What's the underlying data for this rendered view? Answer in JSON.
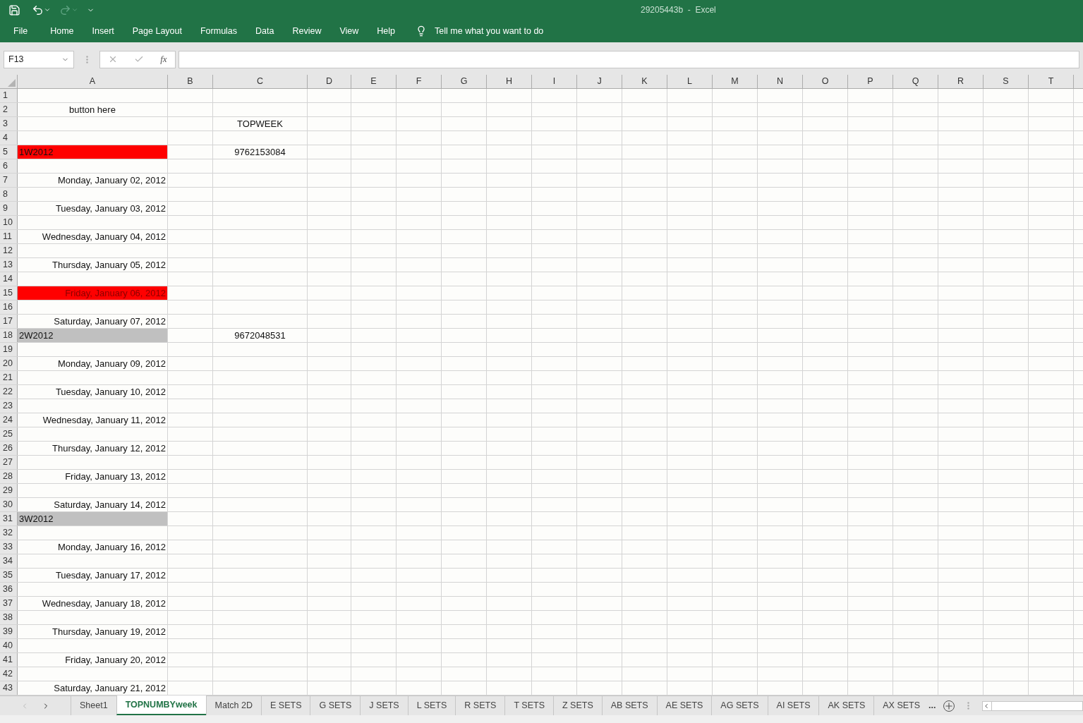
{
  "window": {
    "title": "29205443b  -  Excel"
  },
  "ribbon_tabs": [
    "File",
    "Home",
    "Insert",
    "Page Layout",
    "Formulas",
    "Data",
    "Review",
    "View",
    "Help"
  ],
  "tell_me": "Tell me what you want to do",
  "name_box": "F13",
  "formula_symbol": "fx",
  "columns": [
    "A",
    "B",
    "C",
    "D",
    "E",
    "F",
    "G",
    "H",
    "I",
    "J",
    "K",
    "L",
    "M",
    "N",
    "O",
    "P",
    "Q",
    "R",
    "S",
    "T"
  ],
  "rows": [
    {
      "n": "1"
    },
    {
      "n": "2",
      "a": {
        "text": "button here",
        "kind": "center"
      }
    },
    {
      "n": "3",
      "c": "TOPWEEK"
    },
    {
      "n": "4"
    },
    {
      "n": "5",
      "a": {
        "text": "1W2012",
        "kind": "week"
      },
      "color": "#ff0000",
      "c": "9762153084"
    },
    {
      "n": "6"
    },
    {
      "n": "7",
      "a": {
        "text": "Monday, January 02, 2012",
        "kind": "date"
      }
    },
    {
      "n": "8"
    },
    {
      "n": "9",
      "a": {
        "text": "Tuesday, January 03, 2012",
        "kind": "date"
      }
    },
    {
      "n": "10"
    },
    {
      "n": "11",
      "a": {
        "text": "Wednesday, January 04, 2012",
        "kind": "date"
      }
    },
    {
      "n": "12"
    },
    {
      "n": "13",
      "a": {
        "text": "Thursday, January 05, 2012",
        "kind": "date"
      }
    },
    {
      "n": "14"
    },
    {
      "n": "15",
      "a": {
        "text": "Friday, January 06, 2012",
        "kind": "date"
      },
      "color": "#ff0000"
    },
    {
      "n": "16"
    },
    {
      "n": "17",
      "a": {
        "text": "Saturday, January 07, 2012",
        "kind": "date"
      }
    },
    {
      "n": "18",
      "a": {
        "text": "2W2012",
        "kind": "week"
      },
      "color": "#c0c0c0",
      "c": "9672048531"
    },
    {
      "n": "19"
    },
    {
      "n": "20",
      "a": {
        "text": "Monday, January 09, 2012",
        "kind": "date"
      }
    },
    {
      "n": "21"
    },
    {
      "n": "22",
      "a": {
        "text": "Tuesday, January 10, 2012",
        "kind": "date"
      }
    },
    {
      "n": "23"
    },
    {
      "n": "24",
      "a": {
        "text": "Wednesday, January 11, 2012",
        "kind": "date"
      }
    },
    {
      "n": "25"
    },
    {
      "n": "26",
      "a": {
        "text": "Thursday, January 12, 2012",
        "kind": "date"
      }
    },
    {
      "n": "27"
    },
    {
      "n": "28",
      "a": {
        "text": "Friday, January 13, 2012",
        "kind": "date"
      }
    },
    {
      "n": "29"
    },
    {
      "n": "30",
      "a": {
        "text": "Saturday, January 14, 2012",
        "kind": "date"
      }
    },
    {
      "n": "31",
      "a": {
        "text": "3W2012",
        "kind": "week"
      },
      "color": "#c0c0c0"
    },
    {
      "n": "32"
    },
    {
      "n": "33",
      "a": {
        "text": "Monday, January 16, 2012",
        "kind": "date"
      }
    },
    {
      "n": "34"
    },
    {
      "n": "35",
      "a": {
        "text": "Tuesday, January 17, 2012",
        "kind": "date"
      }
    },
    {
      "n": "36"
    },
    {
      "n": "37",
      "a": {
        "text": "Wednesday, January 18, 2012",
        "kind": "date"
      }
    },
    {
      "n": "38"
    },
    {
      "n": "39",
      "a": {
        "text": "Thursday, January 19, 2012",
        "kind": "date"
      }
    },
    {
      "n": "40"
    },
    {
      "n": "41",
      "a": {
        "text": "Friday, January 20, 2012",
        "kind": "date"
      }
    },
    {
      "n": "42"
    },
    {
      "n": "43",
      "a": {
        "text": "Saturday, January 21, 2012",
        "kind": "date"
      }
    }
  ],
  "sheet_tabs": [
    {
      "label": "Sheet1",
      "selected": false
    },
    {
      "label": "TOPNUMBYweek",
      "selected": true
    },
    {
      "label": "Match 2D",
      "selected": false
    },
    {
      "label": "E SETS",
      "selected": false
    },
    {
      "label": "G SETS",
      "selected": false
    },
    {
      "label": "J SETS",
      "selected": false
    },
    {
      "label": "L SETS",
      "selected": false
    },
    {
      "label": "R SETS",
      "selected": false
    },
    {
      "label": "T SETS",
      "selected": false
    },
    {
      "label": "Z SETS",
      "selected": false
    },
    {
      "label": "AB SETS",
      "selected": false
    },
    {
      "label": "AE SETS",
      "selected": false
    },
    {
      "label": "AG SETS",
      "selected": false
    },
    {
      "label": "AI SETS",
      "selected": false
    },
    {
      "label": "AK SETS",
      "selected": false
    },
    {
      "label": "AX SETS",
      "selected": false
    }
  ],
  "more_tabs": "..."
}
